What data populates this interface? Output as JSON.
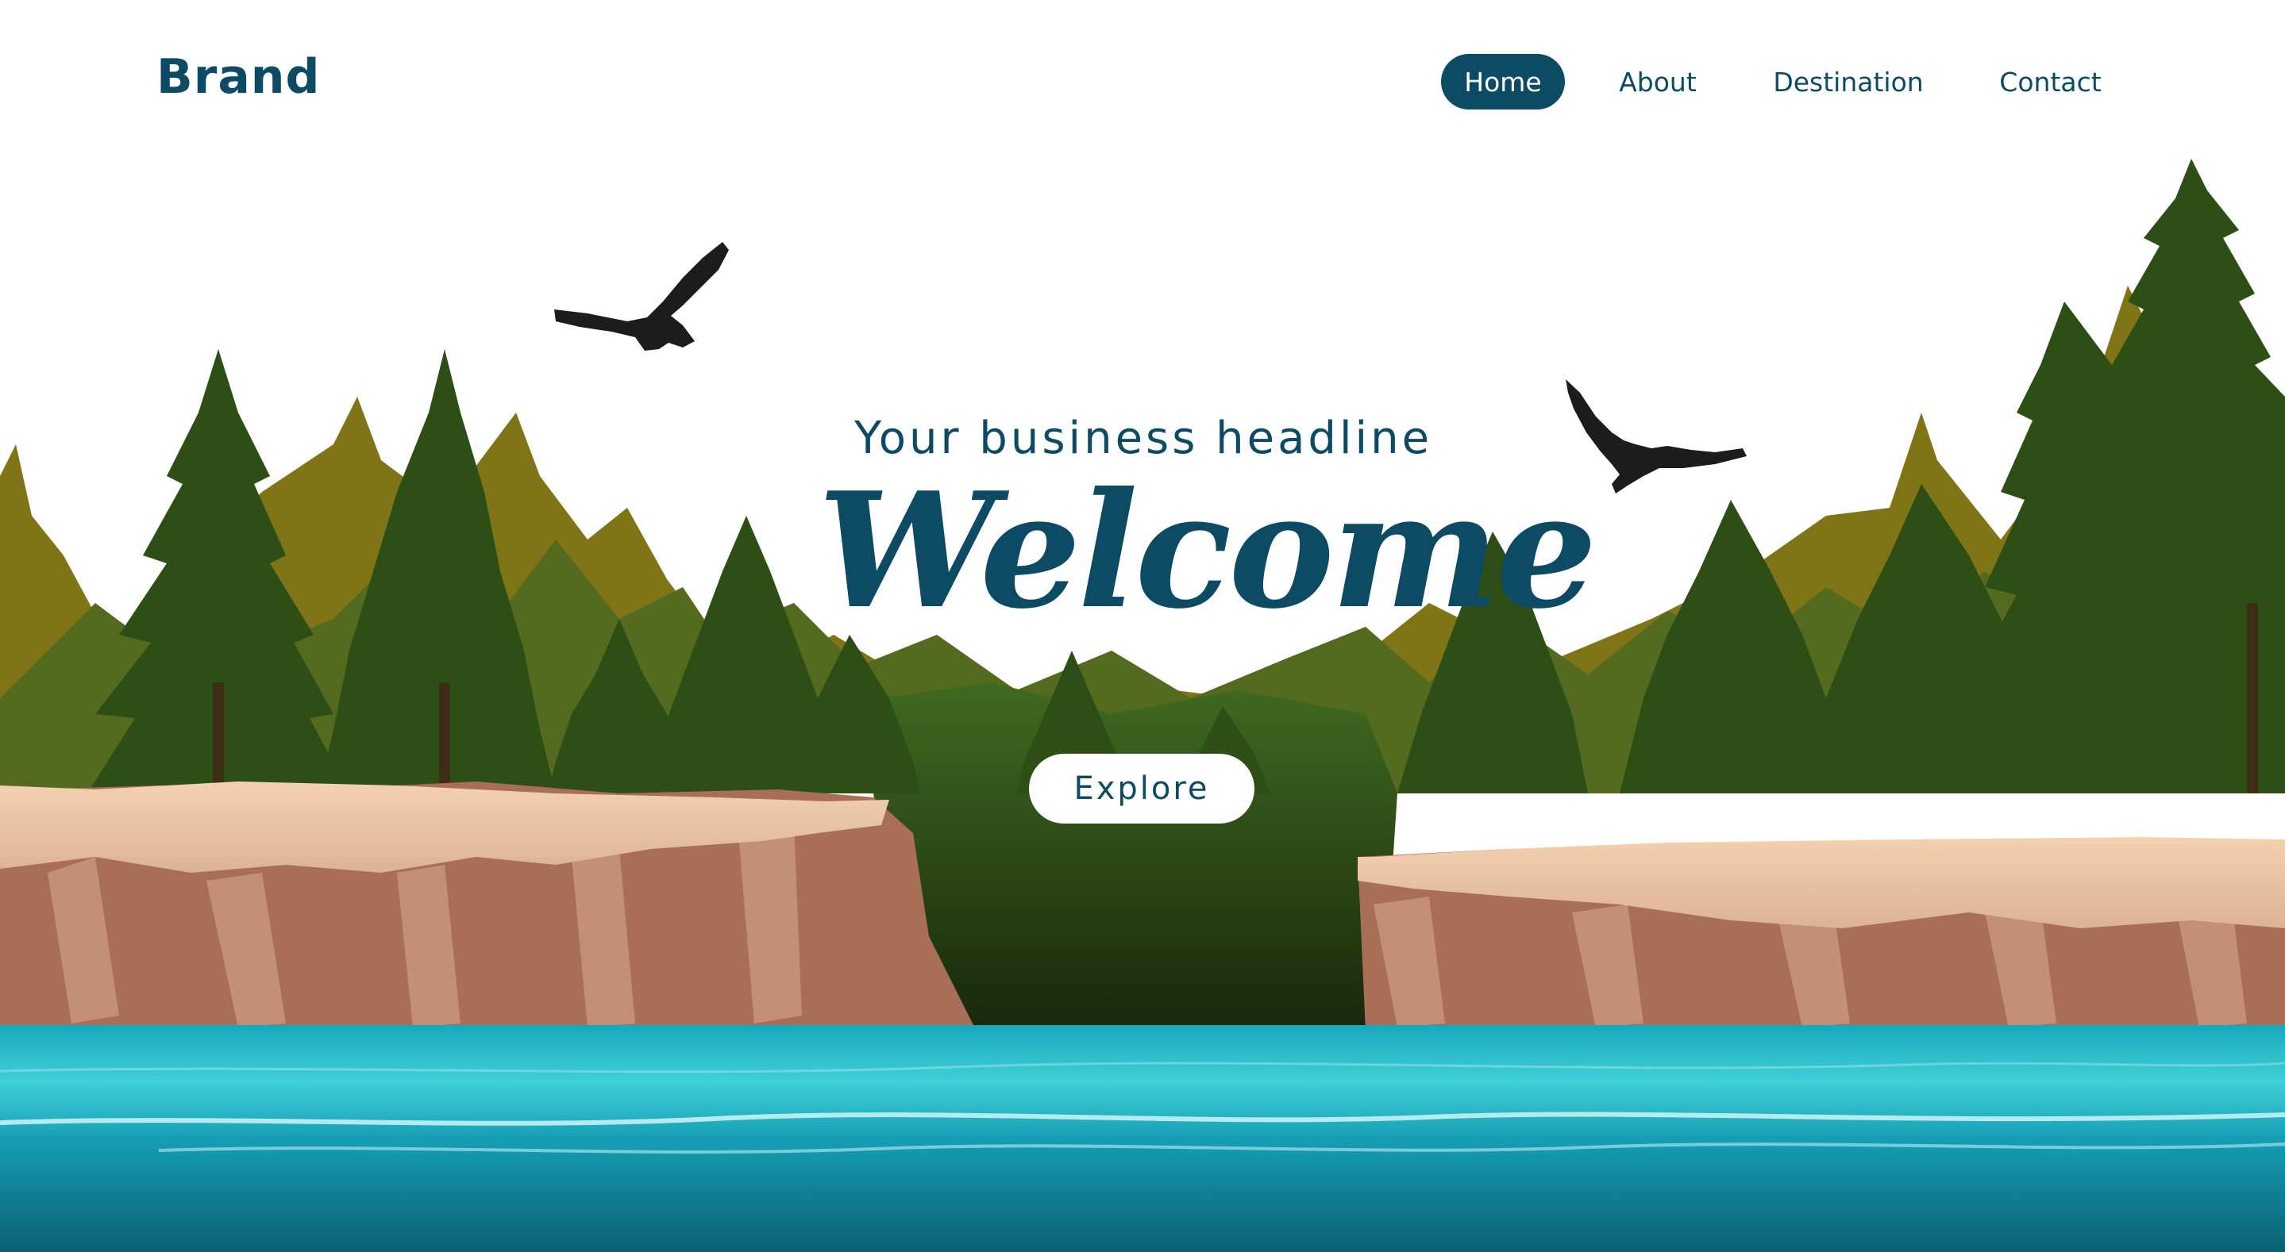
{
  "header": {
    "brand": "Brand",
    "nav": [
      {
        "label": "Home",
        "active": true
      },
      {
        "label": "About",
        "active": false
      },
      {
        "label": "Destination",
        "active": false
      },
      {
        "label": "Contact",
        "active": false
      }
    ]
  },
  "hero": {
    "headline": "Your business headline",
    "title": "Welcome",
    "cta_label": "Explore"
  },
  "colors": {
    "brand": "#0d4a63",
    "background": "#ffffff",
    "forest_dark": "#2c5218",
    "forest_olive": "#7a7418",
    "cliff_top": "#e8c4a0",
    "cliff_face": "#b07a5e",
    "water_light": "#36c7d0",
    "water_deep": "#0e6e82",
    "bird": "#1c1c1c"
  },
  "icons": [
    "eagle-icon",
    "eagle-icon"
  ]
}
